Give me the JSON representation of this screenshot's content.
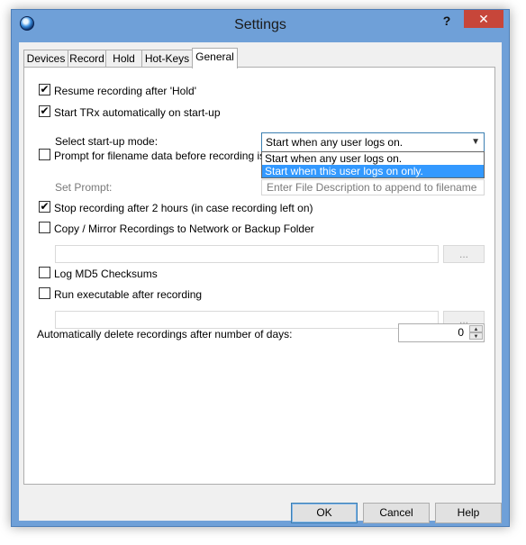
{
  "window": {
    "title": "Settings",
    "help_label": "?",
    "close_label": "✕"
  },
  "tabs": [
    {
      "label": "Devices"
    },
    {
      "label": "Record"
    },
    {
      "label": "Hold"
    },
    {
      "label": "Hot-Keys"
    },
    {
      "label": "General"
    }
  ],
  "general": {
    "resume_after_hold": {
      "label": "Resume recording after 'Hold'",
      "checked": "✔"
    },
    "start_auto": {
      "label": "Start TRx automatically on start-up",
      "checked": "✔"
    },
    "startup_mode": {
      "label": "Select start-up mode:",
      "value": "Start when any user logs on.",
      "options": [
        "Start when any user logs on.",
        "Start when this user logs on only."
      ]
    },
    "prompt_filename": {
      "label": "Prompt for filename data before recording is sta",
      "checked": ""
    },
    "set_prompt": {
      "label": "Set Prompt:",
      "placeholder": "Enter File Description to append to filename"
    },
    "stop_after_2h": {
      "label": "Stop recording after 2 hours (in case recording left on)",
      "checked": "✔"
    },
    "copy_mirror": {
      "label": "Copy / Mirror Recordings to Network or Backup Folder",
      "checked": "",
      "browse_label": "..."
    },
    "log_md5": {
      "label": "Log MD5 Checksums",
      "checked": ""
    },
    "run_exe": {
      "label": "Run executable after recording",
      "checked": "",
      "browse_label": "..."
    },
    "auto_delete": {
      "label": "Automatically delete recordings after number of days:",
      "value": "0"
    }
  },
  "buttons": {
    "ok": "OK",
    "cancel": "Cancel",
    "help": "Help"
  }
}
